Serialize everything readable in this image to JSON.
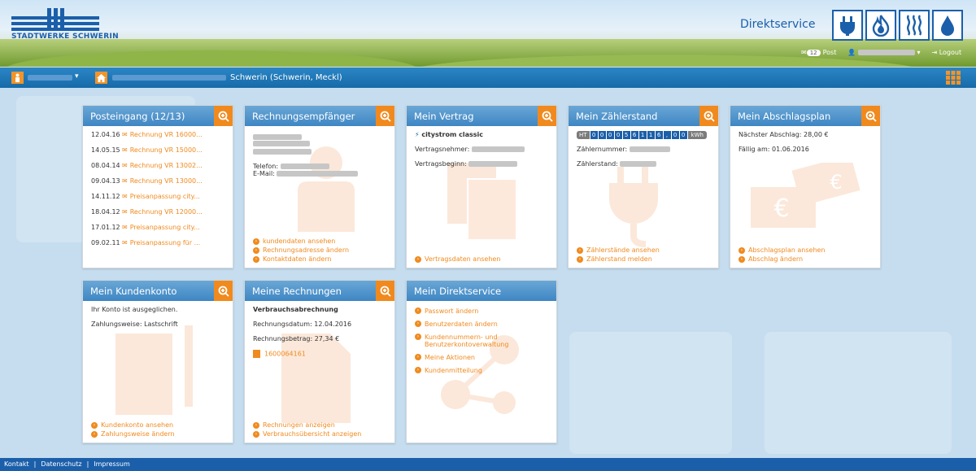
{
  "brand": {
    "logo_text": "STADTWERKE SCHWERIN",
    "section_title": "Direktservice"
  },
  "utility_icons": [
    "plug-icon",
    "flame-icon",
    "heat-icon",
    "water-drop-icon"
  ],
  "topbar": {
    "post_count": "12",
    "post_label": "Post",
    "logout_label": "Logout"
  },
  "navbar": {
    "location": "Schwerin (Schwerin, Meckl)"
  },
  "cards": {
    "posteingang": {
      "title": "Posteingang (12/13)",
      "items": [
        {
          "date": "12.04.16",
          "label": "Rechnung VR 16000..."
        },
        {
          "date": "14.05.15",
          "label": "Rechnung VR 15000..."
        },
        {
          "date": "08.04.14",
          "label": "Rechnung VR 13002..."
        },
        {
          "date": "09.04.13",
          "label": "Rechnung VR 13000..."
        },
        {
          "date": "14.11.12",
          "label": "Preisanpassung city..."
        },
        {
          "date": "18.04.12",
          "label": "Rechnung VR 12000..."
        },
        {
          "date": "17.01.12",
          "label": "Preisanpassung city..."
        },
        {
          "date": "09.02.11",
          "label": "Preisanpassung für ..."
        }
      ]
    },
    "rechnungsempfaenger": {
      "title": "Rechnungsempfänger",
      "phone_label": "Telefon:",
      "email_label": "E-Mail:",
      "links": [
        "kundendaten ansehen",
        "Rechnungsadresse ändern",
        "Kontaktdaten ändern"
      ]
    },
    "vertrag": {
      "title": "Mein Vertrag",
      "product": "citystrom classic",
      "holder_label": "Vertragsnehmer:",
      "start_label": "Vertragsbeginn:",
      "links": [
        "Vertragsdaten ansehen"
      ]
    },
    "zaehlerstand": {
      "title": "Mein Zählerstand",
      "meter_prefix": "HT",
      "meter_digits": [
        "0",
        "0",
        "0",
        "0",
        "5",
        "6",
        "1",
        "1",
        "6"
      ],
      "meter_sep": ",",
      "meter_dec": [
        "0",
        "0"
      ],
      "meter_unit": "kWh",
      "number_label": "Zählernummer:",
      "reading_label": "Zählerstand:",
      "links": [
        "Zählerstände ansehen",
        "Zählerstand melden"
      ]
    },
    "abschlag": {
      "title": "Mein Abschlagsplan",
      "next": "Nächster Abschlag: 28,00 €",
      "due": "Fällig am: 01.06.2016",
      "links": [
        "Abschlagsplan ansehen",
        "Abschlag ändern"
      ]
    },
    "kundenkonto": {
      "title": "Mein Kundenkonto",
      "status": "Ihr Konto ist ausgeglichen.",
      "payment": "Zahlungsweise: Lastschrift",
      "links": [
        "Kundenkonto ansehen",
        "Zahlungsweise ändern"
      ]
    },
    "rechnungen": {
      "title": "Meine Rechnungen",
      "type": "Verbrauchsabrechnung",
      "date": "Rechnungsdatum: 12.04.2016",
      "amount": "Rechnungsbetrag: 27,34 €",
      "invoice": "1600064161",
      "links": [
        "Rechnungen anzeigen",
        "Verbrauchsübersicht anzeigen"
      ]
    },
    "direktservice": {
      "title": "Mein Direktservice",
      "links": [
        "Passwort ändern",
        "Benutzerdaten ändern",
        "Kundennummern- und Benutzerkontoverwaltung",
        "Meine Aktionen",
        "Kundenmitteilung"
      ]
    }
  },
  "footer": {
    "links": [
      "Kontakt",
      "Datenschutz",
      "Impressum"
    ]
  },
  "colors": {
    "accent": "#f08a1e",
    "brand": "#1b5faa",
    "header_blue": "#3e86c3"
  }
}
